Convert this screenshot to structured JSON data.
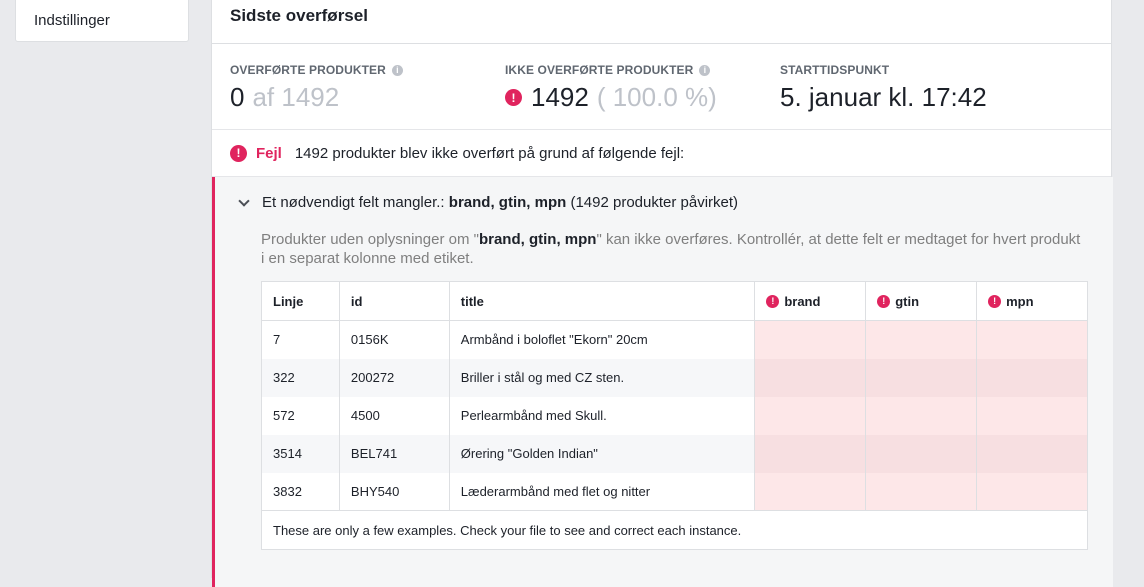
{
  "sidebar": {
    "settings_label": "Indstillinger"
  },
  "panel": {
    "title": "Sidste overførsel"
  },
  "stats": {
    "transferred": {
      "label": "OVERFØRTE PRODUKTER",
      "value": "0",
      "suffix": "af 1492"
    },
    "not_transferred": {
      "label": "IKKE OVERFØRTE PRODUKTER",
      "value": "1492",
      "suffix": "( 100.0 %)"
    },
    "start_time": {
      "label": "STARTTIDSPUNKT",
      "value": "5. januar kl. 17:42"
    }
  },
  "error": {
    "tag": "Fejl",
    "message": "1492 produkter blev ikke overført på grund af følgende fejl:"
  },
  "detail": {
    "head_prefix": "Et nødvendigt felt mangler.:",
    "fields": "brand, gtin, mpn",
    "head_suffix": "(1492 produkter påvirket)",
    "desc_prefix": "Produkter uden oplysninger om \"",
    "desc_fields": "brand, gtin, mpn",
    "desc_suffix": "\" kan ikke overføres. Kontrollér, at dette felt er medtaget for hvert produkt i en separat kolonne med etiket."
  },
  "table": {
    "columns": [
      "Linje",
      "id",
      "title",
      "brand",
      "gtin",
      "mpn"
    ],
    "rows": [
      {
        "linje": "7",
        "id": "0156K",
        "title": "Armbånd i boloflet \"Ekorn\" 20cm"
      },
      {
        "linje": "322",
        "id": "200272",
        "title": "Briller i stål og med CZ sten."
      },
      {
        "linje": "572",
        "id": "4500",
        "title": "Perlearmbånd med Skull."
      },
      {
        "linje": "3514",
        "id": "BEL741",
        "title": "Ørering \"Golden Indian\""
      },
      {
        "linje": "3832",
        "id": "BHY540",
        "title": "Læderarmbånd med flet og nitter"
      }
    ],
    "footer": "These are only a few examples. Check your file to see and correct each instance."
  },
  "icons": {
    "info": "info-icon",
    "error": "error-icon",
    "chevron": "chevron-down-icon"
  },
  "colors": {
    "error": "#e0245e",
    "missing_cell": "#fde7e8"
  }
}
